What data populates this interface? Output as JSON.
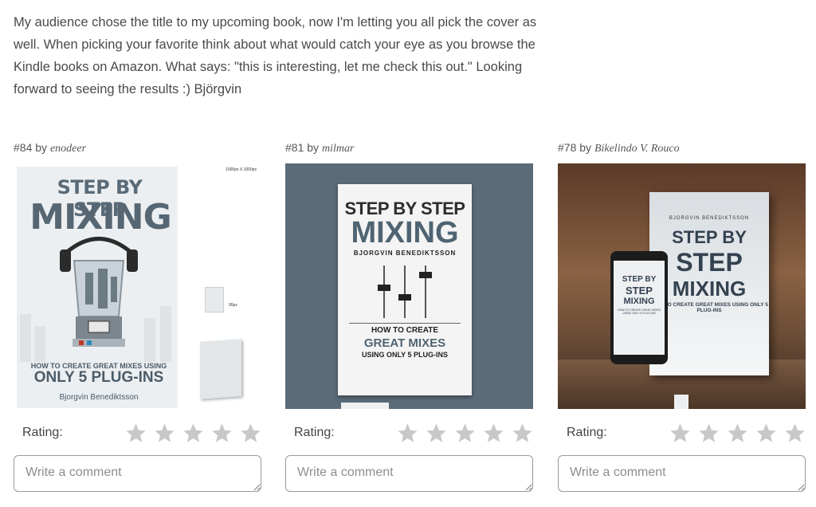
{
  "intro": {
    "text": "My audience chose the title to my upcoming book, now I'm letting you all pick the cover as well. When picking your favorite think about what would catch your eye as you browse the Kindle books on Amazon. What says: \"this is interesting, let me check this out.\" Looking forward to seeing the results :) Björgvin"
  },
  "labels": {
    "by": "by",
    "rating": "Rating:",
    "comment_placeholder": "Write a comment"
  },
  "entries": [
    {
      "number": "#84",
      "author": "enodeer",
      "cover": {
        "title_line1": "STEP BY STEP",
        "title_line2": "MIXING",
        "subtitle_line1": "HOW TO CREATE GREAT MIXES USING",
        "subtitle_line2": "ONLY 5 PLUG-INS",
        "author": "Bjorgvin Benediktsson",
        "dims_note": "1000px X 1000px",
        "small_note": "90px"
      }
    },
    {
      "number": "#81",
      "author": "milmar",
      "cover": {
        "title_line1": "STEP BY STEP",
        "title_line2": "MIXING",
        "author": "BJORGVIN BENEDIKTSSON",
        "subtitle_line1": "HOW TO CREATE",
        "subtitle_line2": "GREAT MIXES",
        "subtitle_line3": "USING ONLY 5 PLUG-INS"
      }
    },
    {
      "number": "#78",
      "author": "Bikelindo V. Rouco",
      "cover": {
        "author": "BJORGVIN BENEDIKTSSON",
        "title_line1": "STEP BY",
        "title_line2": "STEP",
        "title_line3": "MIXING",
        "subtitle": "HOW TO CREATE GREAT MIXES USING ONLY 5 PLUG-INS"
      }
    }
  ],
  "stars_per_entry": 5,
  "colors": {
    "star_inactive": "#c8c8c8",
    "text": "#4a4a4a",
    "border": "#9a9a9a"
  }
}
